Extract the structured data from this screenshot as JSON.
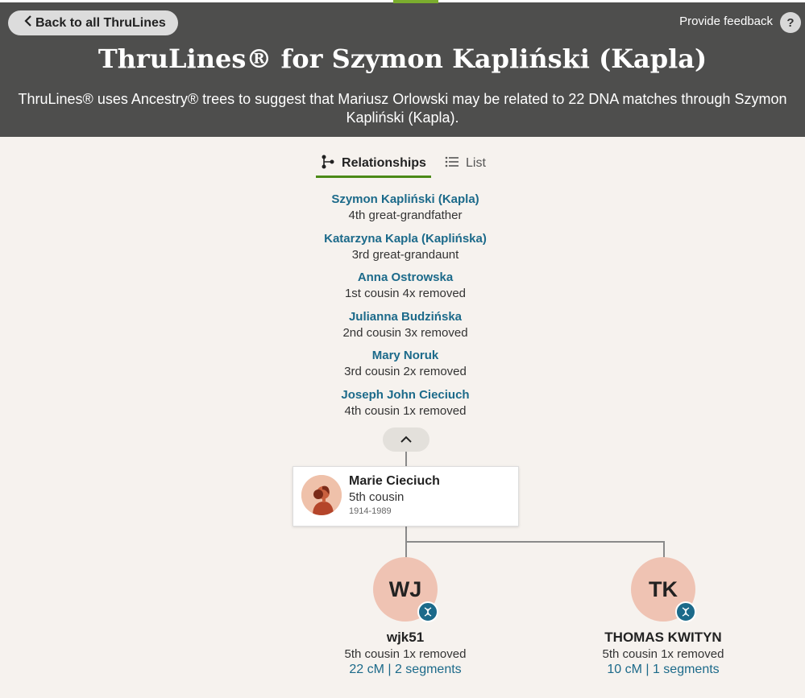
{
  "header": {
    "back_label": "Back to all ThruLines",
    "feedback_label": "Provide feedback",
    "help_label": "?",
    "title": "ThruLines® for Szymon Kapliński (Kapla)",
    "subtitle_line1": "ThruLines® uses Ancestry® trees to suggest that Mariusz Orlowski may be related to 22 DNA matches through Szymon",
    "subtitle_line2": "Kapliński (Kapla)."
  },
  "tabs": [
    {
      "label": "Relationships",
      "active": true
    },
    {
      "label": "List",
      "active": false
    }
  ],
  "ancestors": [
    {
      "name": "Szymon Kapliński (Kapla)",
      "relation": "4th great-grandfather"
    },
    {
      "name": "Katarzyna Kapla (Kaplińska)",
      "relation": "3rd great-grandaunt"
    },
    {
      "name": "Anna Ostrowska",
      "relation": "1st cousin 4x removed"
    },
    {
      "name": "Julianna Budzińska",
      "relation": "2nd cousin 3x removed"
    },
    {
      "name": "Mary Noruk",
      "relation": "3rd cousin 2x removed"
    },
    {
      "name": "Joseph John Cieciuch",
      "relation": "4th cousin 1x removed"
    }
  ],
  "person_card": {
    "name": "Marie Cieciuch",
    "relation": "5th cousin",
    "dates": "1914-1989"
  },
  "matches": [
    {
      "initials": "WJ",
      "name": "wjk51",
      "relation": "5th cousin 1x removed",
      "shared": "22 cM | 2 segments"
    },
    {
      "initials": "TK",
      "name": "THOMAS KWITYN",
      "relation": "5th cousin 1x removed",
      "shared": "10 cM | 1 segments"
    }
  ],
  "colors": {
    "header_bg": "#4e4e4d",
    "accent_green": "#7bad2e",
    "link_blue": "#1c6a8a",
    "match_circle": "#efc3b3"
  }
}
